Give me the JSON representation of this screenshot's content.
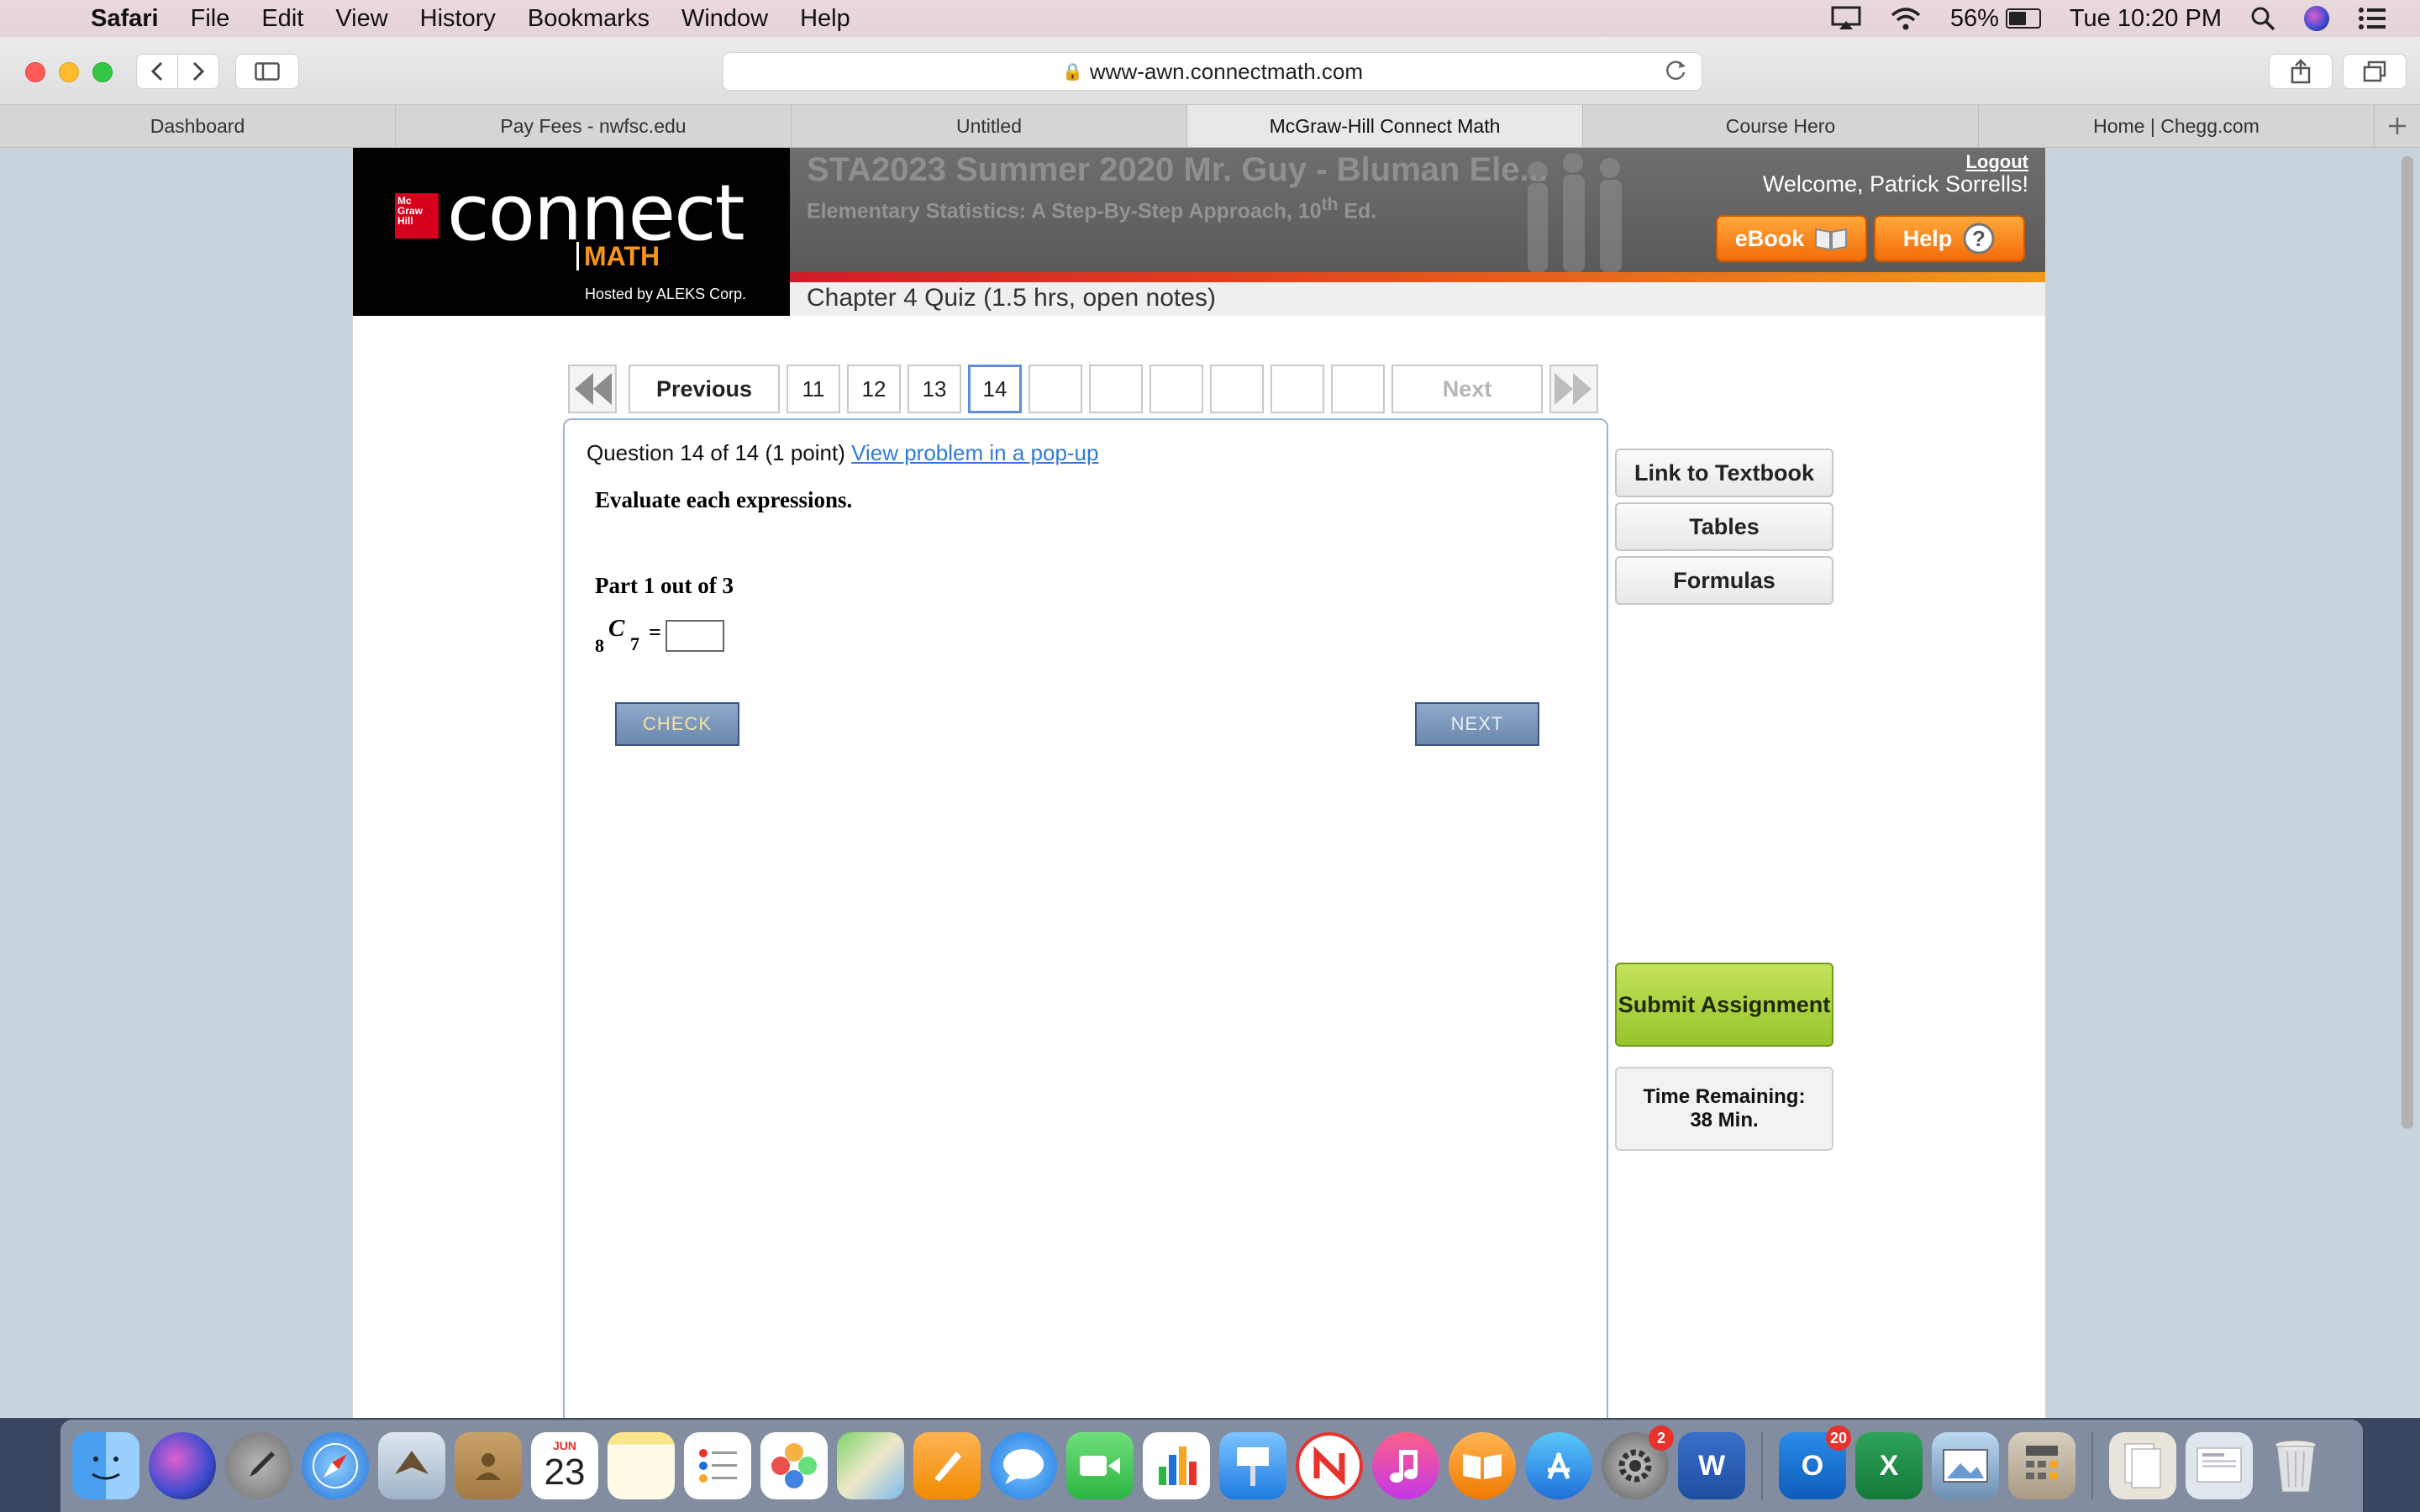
{
  "menubar": {
    "app": "Safari",
    "items": [
      "File",
      "Edit",
      "View",
      "History",
      "Bookmarks",
      "Window",
      "Help"
    ],
    "battery": "56%",
    "clock": "Tue 10:20 PM"
  },
  "browser": {
    "url": "www-awn.connectmath.com",
    "tabs": [
      "Dashboard",
      "Pay Fees - nwfsc.edu",
      "Untitled",
      "McGraw-Hill Connect Math",
      "Course Hero",
      "Home | Chegg.com"
    ],
    "active_tab": 3
  },
  "header": {
    "logo_word": "connect",
    "logo_sub": "MATH",
    "logo_host": "Hosted by ALEKS Corp.",
    "course_title": "STA2023 Summer 2020 Mr. Guy - Bluman Ele...",
    "book_title_pre": "Elementary Statistics: A Step-By-Step Approach, 10",
    "book_title_sup": "th",
    "book_title_post": " Ed.",
    "logout": "Logout",
    "welcome": "Welcome, Patrick Sorrells!",
    "ebook": "eBook",
    "help": "Help",
    "quiz_title": "Chapter 4 Quiz (1.5 hrs, open notes)"
  },
  "pager": {
    "previous": "Previous",
    "pages": [
      "11",
      "12",
      "13",
      "14",
      "",
      "",
      "",
      "",
      "",
      ""
    ],
    "current_page": "14",
    "next": "Next"
  },
  "question": {
    "header": "Question 14 of 14 (1 point)",
    "popup_link": "View problem in a pop-up",
    "instruction": "Evaluate each expressions.",
    "part": "Part 1 out of 3",
    "n": "8",
    "c": "C",
    "r": "7",
    "eq": "=",
    "answer_value": "",
    "check": "CHECK",
    "next": "NEXT"
  },
  "sidebar": {
    "textbook": "Link to Textbook",
    "tables": "Tables",
    "formulas": "Formulas",
    "submit": "Submit Assignment",
    "time_label": "Time Remaining:",
    "time_value": "38 Min."
  },
  "dock": {
    "calendar_month": "JUN",
    "calendar_day": "23",
    "system_prefs_badge": "2",
    "outlook_badge": "20"
  },
  "colors": {
    "accent_link": "#2f7bd8",
    "current_page_border": "#5b8fd6",
    "submit_green": "#97c42d",
    "help_orange": "#f36c0a"
  }
}
